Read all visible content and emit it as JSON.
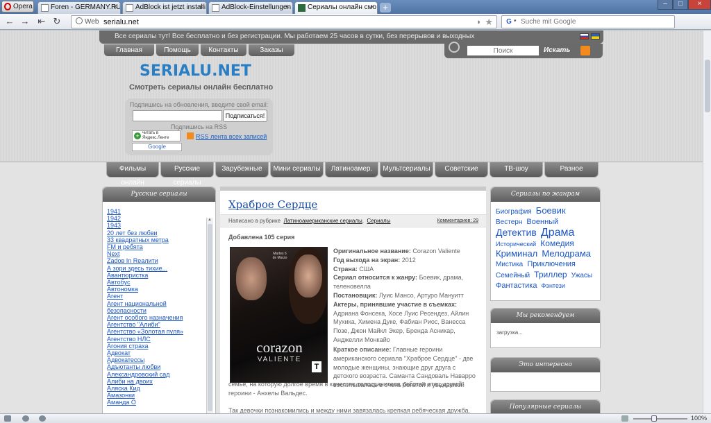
{
  "browser": {
    "opera_label": "Opera",
    "tabs": [
      {
        "title": "Foren - GERMANY.RU -..."
      },
      {
        "title": "AdBlock ist jetzt installi..."
      },
      {
        "title": "AdBlock-Einstellungen"
      },
      {
        "title": "Сериалы онлайн смо..."
      }
    ],
    "active_tab": 3,
    "new_tab": "+",
    "web_label": "Web",
    "url": "serialu.net",
    "search_placeholder": "Suche mit Google",
    "search_engine": "G"
  },
  "site": {
    "top_notice": "Все сериалы тут! Все бесплатно и без регистрации. Мы работаем 25 часов в сутки, без перерывов и выходных",
    "main_menu": [
      "Главная",
      "Помощь",
      "Контакты",
      "Заказы"
    ],
    "search_placeholder": "Поиск",
    "search_button": "Искать",
    "logo": "SERIALU.NET",
    "tagline": "Смотреть сериалы онлайн бесплатно",
    "subscribe": {
      "email_label": "Подпишись на обновления, введите свой email:",
      "button": "Подписаться!",
      "rss_label": "Подпишись на RSS",
      "yandex": "читать в Яндекс.Ленте",
      "google": "Google",
      "rss_link": "RSS лента всех записей"
    },
    "categories": [
      "Фильмы онлайн",
      "Русские сериалы",
      "Зарубежные",
      "Мини сериалы",
      "Латиноамер.",
      "Мультсериалы",
      "Советские",
      "ТВ-шоу",
      "Разное"
    ]
  },
  "left_sidebar": {
    "title": "Русские сериалы",
    "items": [
      "1941",
      "1942",
      "1943",
      "20 лет без любви",
      "33 квадратных метра",
      "FM и ребята",
      "Next",
      "Zadов In Reaлити",
      "А зори здесь тихие...",
      "Авантюристка",
      "Автобус",
      "Автономка",
      "Агент",
      "Агент национальной",
      "безопасности",
      "Агент особого назначения",
      "Агентство \"Алиби\"",
      "Агентство «Золотая пуля»",
      "Агентство НЛС",
      "Агония страха",
      "Адвокат",
      "Адвокатессы",
      "Адъютанты любви",
      "Александровский сад",
      "Алиби на двоих",
      "Аляска Кид",
      "Амазонки",
      "Аманда О"
    ]
  },
  "article": {
    "title": "Храброе Сердце",
    "meta_prefix": "Написано в рубрике",
    "rubric1": "Латиноамериканские сериалы",
    "rubric2": "Сериалы",
    "comments": "Комментариев: 29",
    "added": "Добавлена 105 серия",
    "poster": {
      "title": "corazon",
      "subtitle": "VALIENTE",
      "date": "Martes 6 de Marzo",
      "logo": "T"
    },
    "fields": [
      {
        "label": "Оригинальное название:",
        "value": "Corazon Valiente"
      },
      {
        "label": "Год выхода на экран:",
        "value": "2012"
      },
      {
        "label": "Страна:",
        "value": "США"
      },
      {
        "label": "Сериал относится к жанру:",
        "value": "Боевик, драма, теленовелла"
      },
      {
        "label": "Постановщик:",
        "value": "Луис Мансо, Артуро Мануитт"
      },
      {
        "label": "Актеры, принявшие участие в съемках:",
        "value": "Адриана Фонсека, Хосе Луис Ресендез, Айлин Мухика, Химена Дуке, Фабиан Риос, Ванесса Позе, Джон Майкл Экер, Бренда Асникар, Анджелли Монкайо"
      }
    ],
    "desc_label": "Краткое описание:",
    "desc_text": "Главные героини американского сериала \"Храброе Сердце\" - две молодые женщины, знающие друг друга с детского возраста. Саманта Сандоваль Наварро воспитывалась в очень богатой и уважаемой",
    "desc_cont": "семье, на которую долгое время в качестве телохранителя работал отец другой героини - Анхелы Вальдес.",
    "desc_next": "Так девочки познакомились и между ними завязалась крепкая ребяческая дружба."
  },
  "right_sidebar": {
    "genres_title": "Сериалы по жанрам",
    "tags": [
      {
        "text": "Биография",
        "size": 10
      },
      {
        "text": "Боевик",
        "size": 13
      },
      {
        "text": "Вестерн",
        "size": 10
      },
      {
        "text": "Военный",
        "size": 11
      },
      {
        "text": "Детектив",
        "size": 14
      },
      {
        "text": "Драма",
        "size": 16
      },
      {
        "text": "Исторический",
        "size": 9
      },
      {
        "text": "Комедия",
        "size": 12
      },
      {
        "text": "Криминал",
        "size": 13
      },
      {
        "text": "Мелодрама",
        "size": 13
      },
      {
        "text": "Мистика",
        "size": 10
      },
      {
        "text": "Приключения",
        "size": 11
      },
      {
        "text": "Семейный",
        "size": 10
      },
      {
        "text": "Триллер",
        "size": 12
      },
      {
        "text": "Ужасы",
        "size": 10
      },
      {
        "text": "Фантастика",
        "size": 11
      },
      {
        "text": "Фэнтези",
        "size": 9
      }
    ],
    "recommend_title": "Мы рекомендуем",
    "loading": "загрузка...",
    "interesting_title": "Это интересно",
    "popular_title": "Популярные сериалы"
  },
  "status": {
    "zoom": "100%"
  },
  "colors": {
    "link": "#1a55c4",
    "logo": "#2a7fc4",
    "menu_dark": "#5f5f5f"
  }
}
